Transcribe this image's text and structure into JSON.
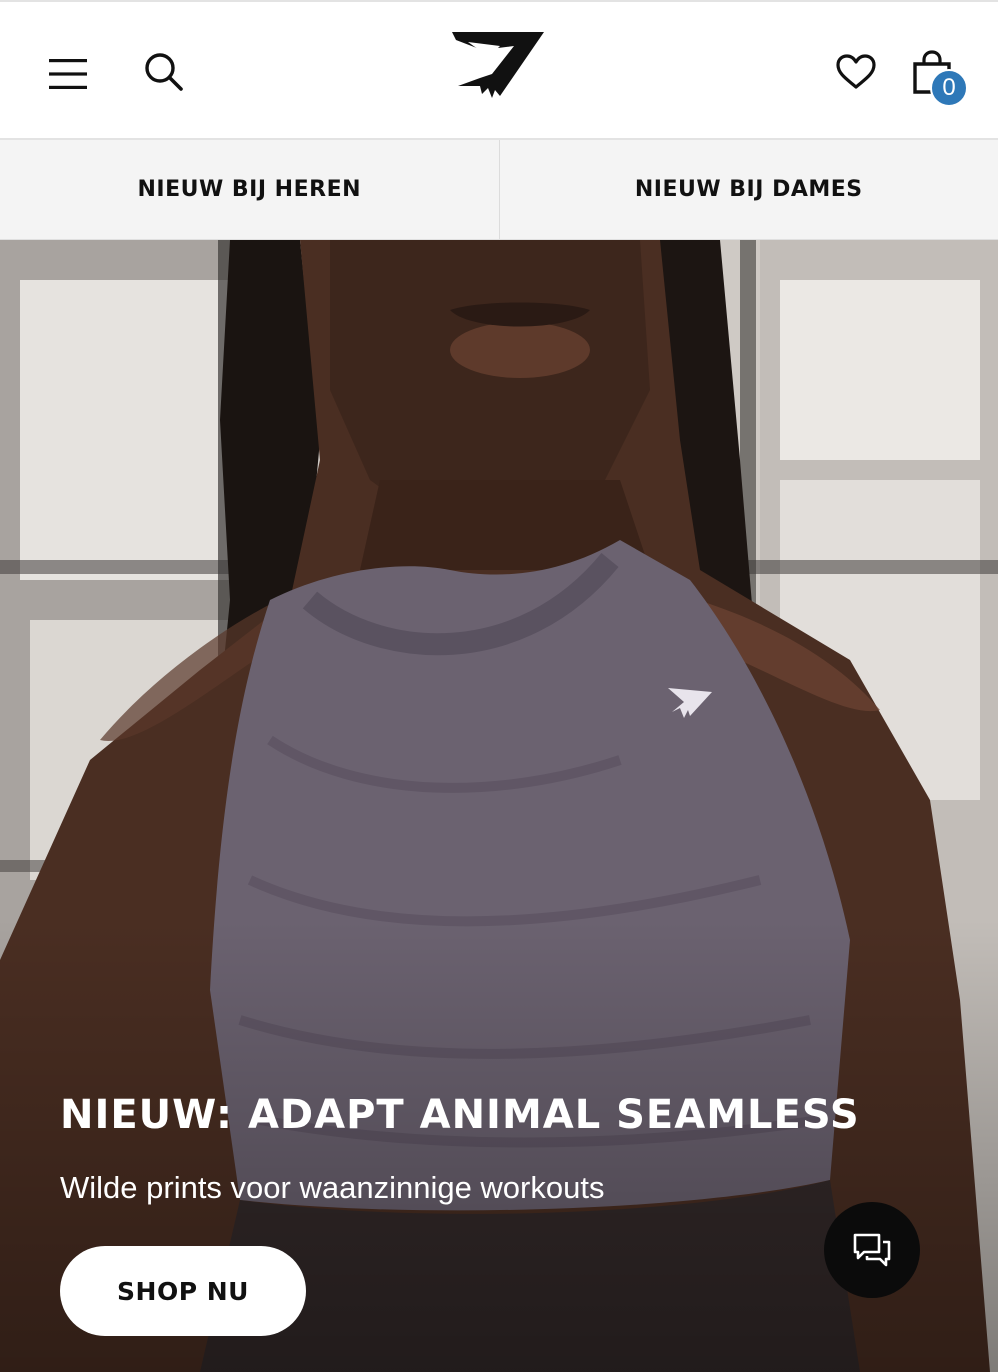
{
  "header": {
    "cart_count": "0"
  },
  "tabs": [
    {
      "label": "NIEUW BIJ HEREN"
    },
    {
      "label": "NIEUW BIJ DAMES"
    }
  ],
  "hero": {
    "title": "NIEUW: ADAPT ANIMAL SEAMLESS",
    "subtitle": "Wilde prints voor waanzinnige workouts",
    "cta_label": "SHOP NU"
  },
  "icons": {
    "menu": "hamburger-menu-icon",
    "search": "search-icon",
    "logo": "gymshark-logo",
    "wishlist": "heart-icon",
    "cart": "shopping-bag-icon",
    "chat": "chat-icon"
  },
  "colors": {
    "badge": "#2e78b8",
    "tab_background": "#f4f4f4",
    "chat_button": "#0b0b0b",
    "cta_background": "#ffffff",
    "top_fabric": "#6b6270"
  }
}
